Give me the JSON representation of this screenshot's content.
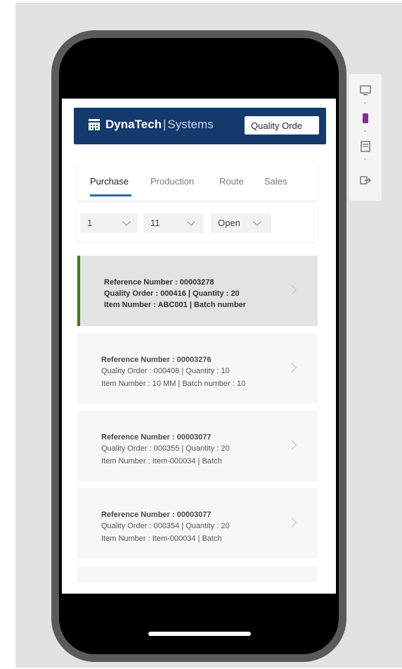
{
  "brand": {
    "name": "DynaTech",
    "separator": "|",
    "suffix": "Systems",
    "header_button": "Quality Orde"
  },
  "tabs": [
    {
      "label": "Purchase",
      "active": true
    },
    {
      "label": "Production",
      "active": false
    },
    {
      "label": "Route",
      "active": false
    },
    {
      "label": "Sales",
      "active": false
    }
  ],
  "filters": [
    {
      "value": "1"
    },
    {
      "value": "11"
    },
    {
      "value": "Open"
    }
  ],
  "orders": [
    {
      "line1": "Reference Number : 00003278",
      "line2": "Quality Order : 000416 | Quantity : 20",
      "line3": "Item Number : ABC001 | Batch number",
      "selected": true
    },
    {
      "line1": "Reference Number : 00003276",
      "line2": "Quality Order : 000408 | Quantity : 10",
      "line3": "Item Number : 10 MM | Batch number : 10",
      "selected": false
    },
    {
      "line1": "Reference Number : 00003077",
      "line2": "Quality Order : 000355 | Quantity : 20",
      "line3": "Item Number : Item-000034 | Batch",
      "selected": false
    },
    {
      "line1": "Reference Number : 00003077",
      "line2": "Quality Order : 000354 | Quantity : 20",
      "line3": "Item Number : Item-000034 | Batch",
      "selected": false
    }
  ],
  "side_panel": {
    "icons": [
      "monitor-icon",
      "phone-icon",
      "tablet-icon",
      "exit-icon"
    ]
  },
  "colors": {
    "header": "#143a6b",
    "tab_underline": "#2b6cb0",
    "selected_marker": "#3e7d20",
    "phone_accent": "#8a2a9a"
  }
}
